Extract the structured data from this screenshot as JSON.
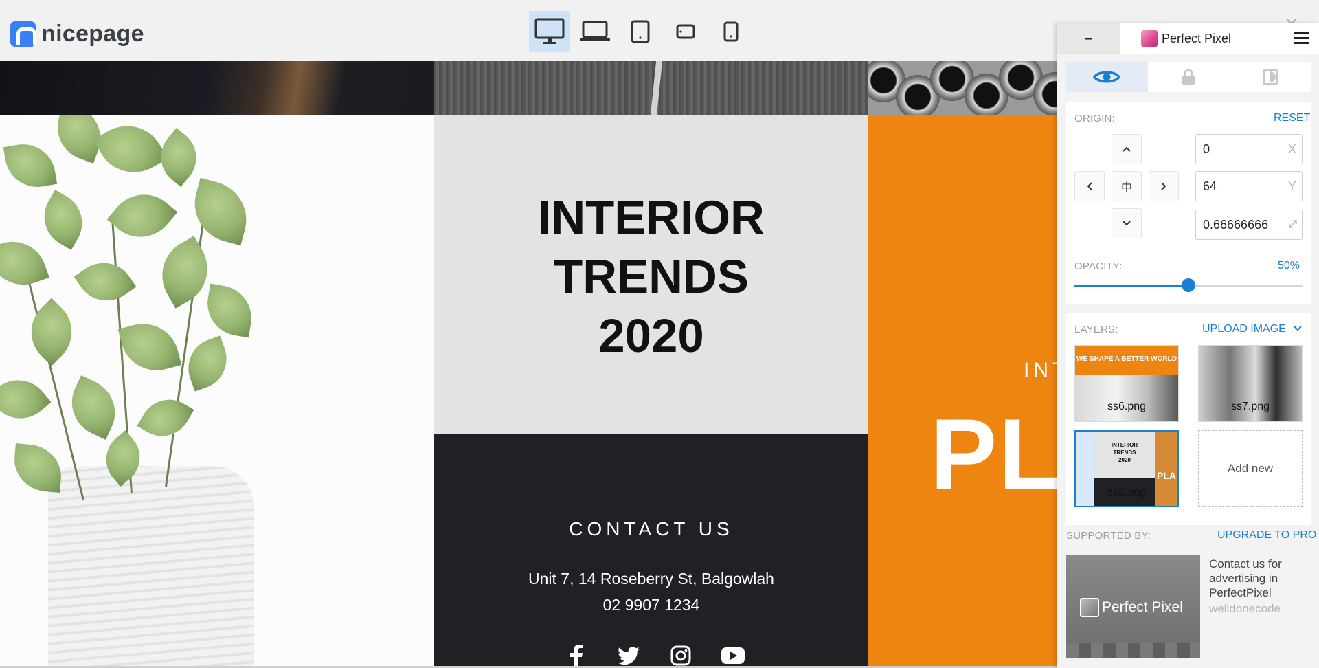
{
  "app": {
    "brand": "nicepage",
    "device_buttons": [
      {
        "name": "desktop",
        "active": true
      },
      {
        "name": "laptop",
        "active": false
      },
      {
        "name": "tablet",
        "active": false
      },
      {
        "name": "tablet-landscape",
        "active": false
      },
      {
        "name": "phone",
        "active": false
      }
    ]
  },
  "page": {
    "hero_title_lines": [
      "INTERIOR",
      "TRENDS",
      "2020"
    ],
    "contact": {
      "title": "CONTACT US",
      "address": "Unit 7, 14 Roseberry St, Balgowlah",
      "phone": "02 9907 1234",
      "socials": [
        "facebook-icon",
        "twitter-icon",
        "instagram-icon",
        "youtube-icon"
      ]
    },
    "right_small": "INT",
    "right_big": "PLA",
    "accent_color": "#ee8510"
  },
  "panel": {
    "minimize_label": "–",
    "title": "Perfect Pixel",
    "tabs": [
      "eye-icon",
      "lock-icon",
      "invert-icon"
    ],
    "origin": {
      "label": "ORIGIN:",
      "reset": "RESET",
      "x": "0",
      "x_suffix": "X",
      "y": "64",
      "y_suffix": "Y",
      "scale": "0.66666666",
      "center_glyph": "中"
    },
    "opacity": {
      "label": "OPACITY:",
      "value": "50%",
      "fraction": 0.5
    },
    "layers": {
      "label": "LAYERS:",
      "upload": "UPLOAD IMAGE",
      "items": [
        {
          "name": "ss6.png",
          "caption": "WE SHAPE A BETTER WORLD",
          "selected": false
        },
        {
          "name": "ss7.png",
          "selected": false
        },
        {
          "name": "ss8.png",
          "caption_lines": [
            "INTERIOR",
            "TRENDS",
            "2020"
          ],
          "selected": true
        }
      ],
      "add_new": "Add new"
    },
    "supported": {
      "label": "SUPPORTED BY:",
      "upgrade": "UPGRADE TO PRO",
      "ad_logo_text": "Perfect Pixel",
      "ad_text": "Contact us for advertising in PerfectPixel",
      "ad_sub": "welldonecode"
    }
  }
}
